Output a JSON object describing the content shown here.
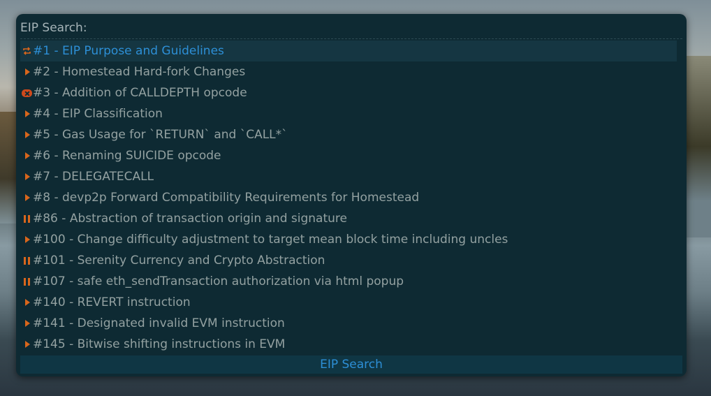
{
  "prompt": {
    "label": "EIP Search:",
    "value": ""
  },
  "items": [
    {
      "status_icon": "loop-icon",
      "text": "#1 - EIP Purpose and Guidelines",
      "selected": true
    },
    {
      "status_icon": "triangle-icon",
      "text": "#2 - Homestead Hard-fork Changes"
    },
    {
      "status_icon": "x-icon",
      "text": "#3 - Addition of CALLDEPTH opcode"
    },
    {
      "status_icon": "triangle-icon",
      "text": "#4 - EIP Classification"
    },
    {
      "status_icon": "triangle-icon",
      "text": "#5 - Gas Usage for `RETURN` and `CALL*`"
    },
    {
      "status_icon": "triangle-icon",
      "text": "#6 - Renaming SUICIDE opcode"
    },
    {
      "status_icon": "triangle-icon",
      "text": "#7 - DELEGATECALL"
    },
    {
      "status_icon": "triangle-icon",
      "text": "#8 - devp2p Forward Compatibility Requirements for Homestead"
    },
    {
      "status_icon": "pause-icon",
      "text": "#86 - Abstraction of transaction origin and signature"
    },
    {
      "status_icon": "triangle-icon",
      "text": "#100 - Change difficulty adjustment to target mean block time including uncles"
    },
    {
      "status_icon": "pause-icon",
      "text": "#101 - Serenity Currency and Crypto Abstraction"
    },
    {
      "status_icon": "pause-icon",
      "text": "#107 - safe eth_sendTransaction authorization via html popup"
    },
    {
      "status_icon": "triangle-icon",
      "text": "#140 - REVERT instruction"
    },
    {
      "status_icon": "triangle-icon",
      "text": "#141 - Designated invalid EVM instruction"
    },
    {
      "status_icon": "triangle-icon",
      "text": "#145 - Bitwise shifting instructions in EVM"
    }
  ],
  "footer": {
    "title": "EIP Search"
  },
  "colors": {
    "background": "#0e2a33",
    "text": "#93a1a1",
    "accent": "#2d8fd6",
    "icon": "#d9661c"
  }
}
